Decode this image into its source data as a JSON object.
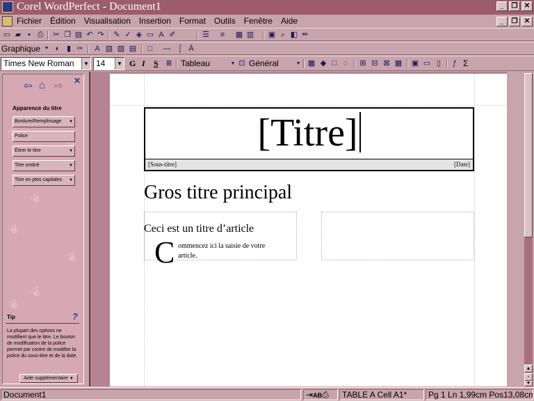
{
  "window": {
    "title": "Corel WordPerfect - Document1",
    "controls": [
      "_",
      "❐",
      "✕"
    ]
  },
  "menu": {
    "items": [
      "Fichier",
      "Édition",
      "Visualisation",
      "Insertion",
      "Format",
      "Outils",
      "Fenêtre",
      "Aide"
    ]
  },
  "toolbar2": {
    "graphique_label": "Graphique"
  },
  "propbar": {
    "font": "Times New Roman",
    "size": "14",
    "bold": "G",
    "italic": "I",
    "underline": "S",
    "tableau": "Tableau",
    "general": "Général",
    "sigma": "Σ"
  },
  "leftpane": {
    "title": "Apparence du titre",
    "buttons": [
      "Bordure/Remplissage",
      "Police",
      "Étirer le titre",
      "Titre ombré",
      "Titre en ptes capitales"
    ],
    "tip_heading": "Tip",
    "tip_text": "La plupart des options ne modifient que le titre. Le bouton de modification de la police permet par contre de modifier la police du sous-titre et de la date.",
    "more_button": "Aide supplémentaire"
  },
  "document": {
    "title_placeholder": "[Titre]",
    "subtitle_placeholder": "[Sous-titre]",
    "date_placeholder": "[Date]",
    "headline": "Gros titre principal",
    "article_title": "Ceci est un titre d’article",
    "dropcap": "C",
    "article_body": "ommencez ici la saisie de votre article."
  },
  "status": {
    "document": "Document1",
    "table_cell": "TABLE A Cell  A1*",
    "position": "Pg 1 Ln 1,99cm Pos13,08cm"
  },
  "colors": {
    "titlebar": "#9c5c6c",
    "chrome": "#c8a4ac",
    "pane": "#d6a8b4",
    "doc_background": "#b48494"
  }
}
